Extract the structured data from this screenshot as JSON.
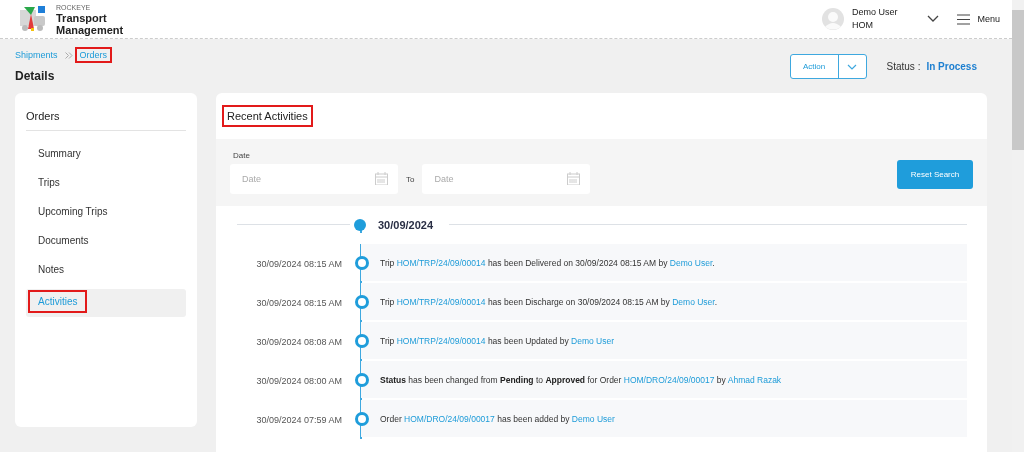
{
  "header": {
    "brand": {
      "company": "ROCKEYE",
      "product_line1": "Transport",
      "product_line2": "Management"
    },
    "user": {
      "name": "Demo User",
      "role": "HOM"
    },
    "menu_label": "Menu"
  },
  "breadcrumb": [
    {
      "label": "Shipments",
      "highlighted": false
    },
    {
      "label": "Orders",
      "highlighted": true
    }
  ],
  "page_title": "Details",
  "action_button": "Action",
  "status": {
    "label": "Status :",
    "value": "In Process"
  },
  "sidebar": {
    "title": "Orders",
    "items": [
      {
        "label": "Summary",
        "selected": false,
        "highlighted": false
      },
      {
        "label": "Trips",
        "selected": false,
        "highlighted": false
      },
      {
        "label": "Upcoming Trips",
        "selected": false,
        "highlighted": false
      },
      {
        "label": "Documents",
        "selected": false,
        "highlighted": false
      },
      {
        "label": "Notes",
        "selected": false,
        "highlighted": false
      },
      {
        "label": "Activities",
        "selected": true,
        "highlighted": true
      }
    ]
  },
  "activities": {
    "title": "Recent Activities",
    "title_highlighted": true,
    "filter": {
      "label": "Date",
      "from_placeholder": "Date",
      "separator": "To",
      "to_placeholder": "Date",
      "reset_button": "Reset Search"
    },
    "groups": [
      {
        "date": "30/09/2024",
        "entries": [
          {
            "time": "30/09/2024 08:15 AM",
            "message": [
              {
                "kind": "plain",
                "text": "Trip "
              },
              {
                "kind": "link",
                "text": "HOM/TRP/24/09/00014"
              },
              {
                "kind": "plain",
                "text": " has been Delivered on 30/09/2024 08:15 AM by "
              },
              {
                "kind": "link",
                "text": "Demo User"
              },
              {
                "kind": "plain",
                "text": "."
              }
            ]
          },
          {
            "time": "30/09/2024 08:15 AM",
            "message": [
              {
                "kind": "plain",
                "text": "Trip "
              },
              {
                "kind": "link",
                "text": "HOM/TRP/24/09/00014"
              },
              {
                "kind": "plain",
                "text": " has been Discharge on 30/09/2024 08:15 AM by "
              },
              {
                "kind": "link",
                "text": "Demo User"
              },
              {
                "kind": "plain",
                "text": "."
              }
            ]
          },
          {
            "time": "30/09/2024 08:08 AM",
            "message": [
              {
                "kind": "plain",
                "text": "Trip "
              },
              {
                "kind": "link",
                "text": "HOM/TRP/24/09/00014"
              },
              {
                "kind": "plain",
                "text": " has been Updated by "
              },
              {
                "kind": "link",
                "text": "Demo User"
              }
            ]
          },
          {
            "time": "30/09/2024 08:00 AM",
            "message": [
              {
                "kind": "bold",
                "text": "Status"
              },
              {
                "kind": "plain",
                "text": " has been changed from "
              },
              {
                "kind": "bold",
                "text": "Pending"
              },
              {
                "kind": "plain",
                "text": " to "
              },
              {
                "kind": "bold",
                "text": "Approved"
              },
              {
                "kind": "plain",
                "text": " for Order "
              },
              {
                "kind": "link",
                "text": "HOM/DRO/24/09/00017"
              },
              {
                "kind": "plain",
                "text": " by "
              },
              {
                "kind": "link",
                "text": "Ahmad Razak"
              }
            ]
          },
          {
            "time": "30/09/2024 07:59 AM",
            "message": [
              {
                "kind": "plain",
                "text": "Order "
              },
              {
                "kind": "link",
                "text": "HOM/DRO/24/09/00017"
              },
              {
                "kind": "plain",
                "text": " has been added by "
              },
              {
                "kind": "link",
                "text": "Demo User"
              }
            ]
          }
        ]
      }
    ]
  }
}
